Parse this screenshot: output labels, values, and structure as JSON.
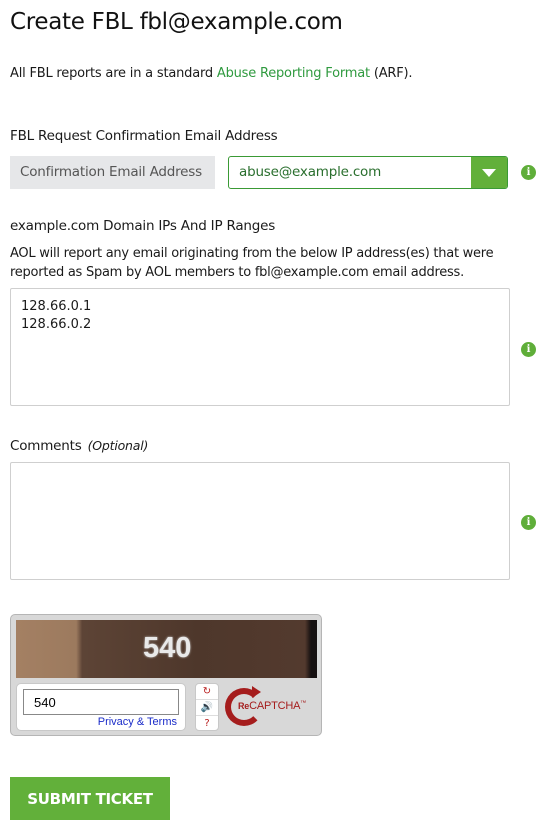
{
  "page": {
    "title": "Create FBL fbl@example.com",
    "intro": {
      "prefix": "All FBL reports are in a standard ",
      "link": "Abuse Reporting Format",
      "suffix": " (ARF)."
    }
  },
  "confirmation": {
    "section_label": "FBL Request Confirmation Email Address",
    "addon_label": "Confirmation Email Address",
    "selected_value": "abuse@example.com",
    "info_icon": "i"
  },
  "ips": {
    "section_label": "example.com Domain IPs And IP Ranges",
    "description": "AOL will report any email originating from the below IP address(es) that were reported as Spam by AOL members to fbl@example.com email address.",
    "value": "128.66.0.1\n128.66.0.2",
    "info_icon": "i"
  },
  "comments": {
    "label": "Comments",
    "optional": "(Optional)",
    "value": "",
    "info_icon": "i"
  },
  "captcha": {
    "image_word": "540",
    "input_value": "540",
    "privacy_link": "Privacy & Terms",
    "buttons": {
      "refresh": "↻",
      "audio": "🔊",
      "help": "?"
    },
    "logo_re": "Re",
    "logo_text": "CAPTCHA",
    "logo_tm": "™"
  },
  "submit": {
    "label": "SUBMIT TICKET"
  },
  "colors": {
    "accent_green": "#62b03a",
    "link_green": "#2f9a3f",
    "captcha_red": "#a51d1d"
  }
}
